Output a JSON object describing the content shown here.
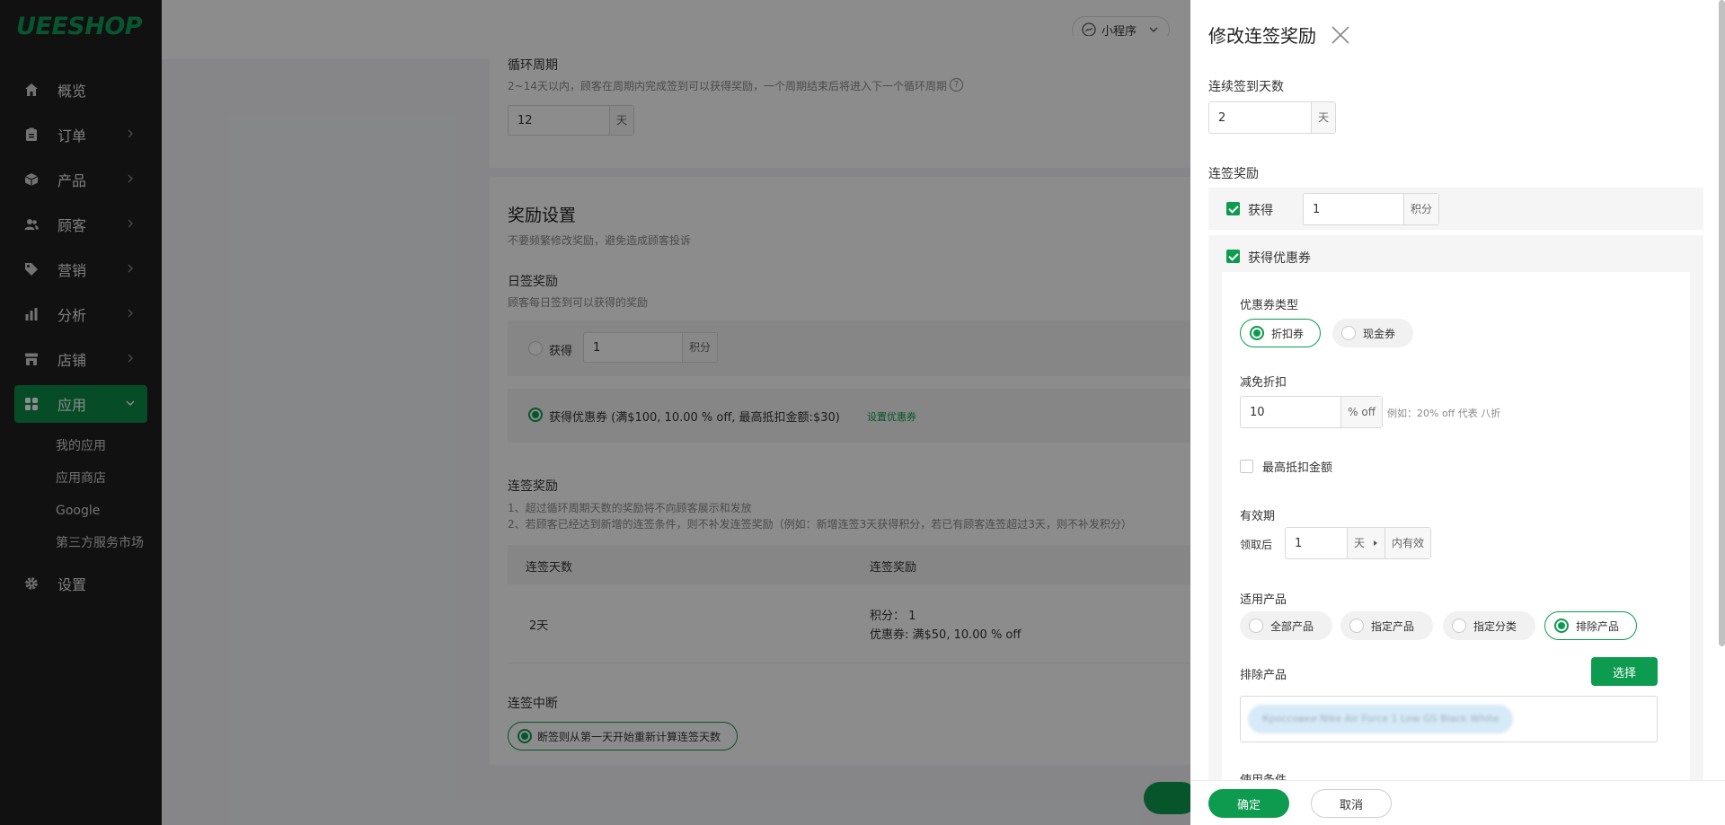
{
  "brand": {
    "logo": "UEESHOP",
    "accent": "#0c9b4f"
  },
  "sidebar": {
    "items": [
      {
        "label": "概览",
        "icon": "home-icon"
      },
      {
        "label": "订单",
        "icon": "clipboard-icon"
      },
      {
        "label": "产品",
        "icon": "box-icon"
      },
      {
        "label": "顾客",
        "icon": "users-icon"
      },
      {
        "label": "营销",
        "icon": "tag-icon"
      },
      {
        "label": "分析",
        "icon": "bar-chart-icon"
      },
      {
        "label": "店铺",
        "icon": "store-icon"
      },
      {
        "label": "应用",
        "icon": "grid-icon"
      },
      {
        "label": "设置",
        "icon": "gear-icon"
      }
    ],
    "subitems": [
      "我的应用",
      "应用商店",
      "Google",
      "第三方服务市场"
    ]
  },
  "topbar": {
    "miniprogram": "小程序"
  },
  "cycle": {
    "title": "循环周期",
    "desc": "2~14天以内，顾客在周期内完成签到可以获得奖励，一个周期结束后将进入下一个循环周期",
    "value": "12",
    "unit": "天"
  },
  "reward": {
    "title": "奖励设置",
    "desc": "不要频繁修改奖励，避免造成顾客投诉",
    "daily_title": "日签奖励",
    "daily_desc": "顾客每日签到可以获得的奖励",
    "get_label": "获得",
    "points_value": "1",
    "points_unit": "积分",
    "coupon_text": "获得优惠券 (满$100,  10.00 % off,  最高抵扣金额:$30)",
    "coupon_link": "设置优惠券",
    "streak_title": "连签奖励",
    "streak_note1": "1、超过循环周期天数的奖励将不向顾客展示和发放",
    "streak_note2": "2、若顾客已经达到新增的连签条件，则不补发连签奖励（例如：新增连签3天获得积分，若已有顾客连签超过3天，则不补发积分）",
    "table_headers": [
      "连签天数",
      "连签奖励"
    ],
    "table_rows": [
      {
        "days": "2天",
        "points": "积分：  1",
        "coupon": "优惠券:   满$50,  10.00 % off"
      }
    ],
    "break_title": "连签中断",
    "break_option": "断签则从第一天开始重新计算连签天数"
  },
  "drawer": {
    "title": "修改连签奖励",
    "days_label": "连续签到天数",
    "days_value": "2",
    "days_unit": "天",
    "reward_label": "连签奖励",
    "get_label": "获得",
    "points_value": "1",
    "points_unit": "积分",
    "coupon_check_label": "获得优惠券",
    "coupon_type_label": "优惠券类型",
    "coupon_types": [
      "折扣券",
      "现金券"
    ],
    "discount_label": "减免折扣",
    "discount_value": "10",
    "discount_unit": "% off",
    "discount_hint": "例如：20% off 代表 八折",
    "max_deduct_label": "最高抵扣金额",
    "validity_label": "有效期",
    "validity_prefix": "领取后",
    "validity_value": "1",
    "validity_unit": "天",
    "validity_suffix": "内有效",
    "products_label": "适用产品",
    "product_options": [
      "全部产品",
      "指定产品",
      "指定分类",
      "排除产品"
    ],
    "exclude_label": "排除产品",
    "select_button": "选择",
    "excluded_product": "Кроссовки Nike Air Force 1 Low GS Black White",
    "usage_label": "使用条件",
    "confirm_button": "确定",
    "cancel_button": "取消"
  }
}
